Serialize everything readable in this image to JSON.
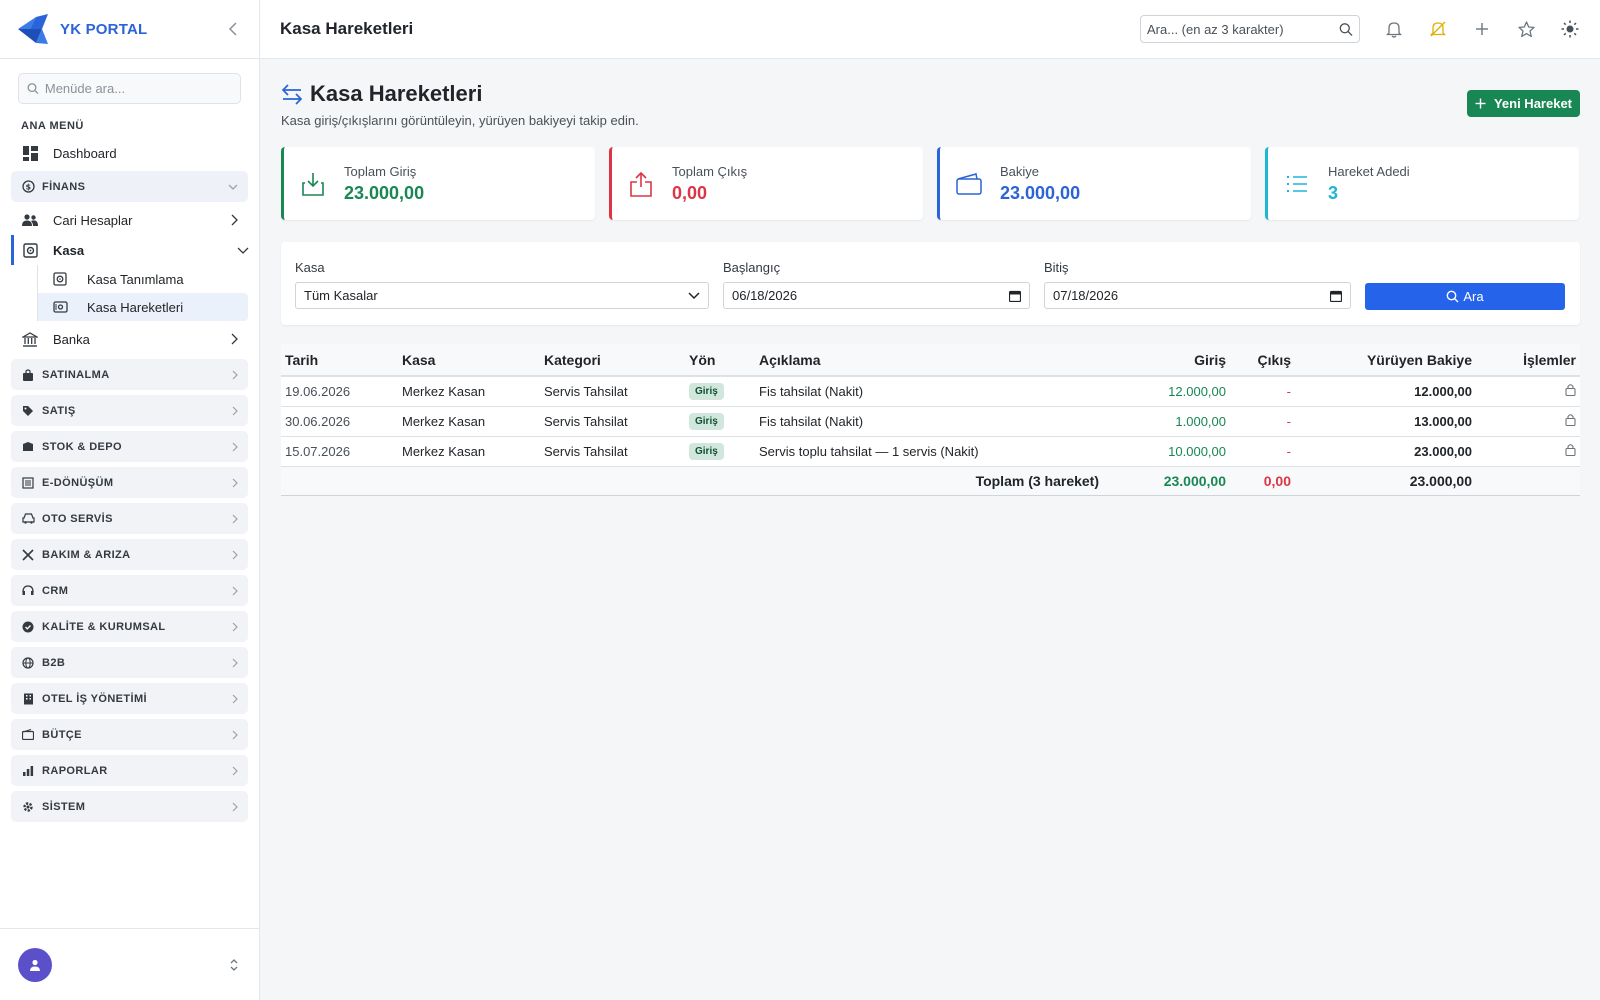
{
  "brand": {
    "name": "YK PORTAL"
  },
  "sidebar": {
    "search_placeholder": "Menüde ara...",
    "section_title": "ANA MENÜ",
    "dashboard": "Dashboard",
    "finans": "FİNANS",
    "cari": "Cari Hesaplar",
    "kasa": "Kasa",
    "kasa_tanimlama": "Kasa Tanımlama",
    "kasa_hareketleri": "Kasa Hareketleri",
    "banka": "Banka",
    "groups": [
      "SATINALMA",
      "SATIŞ",
      "STOK & DEPO",
      "E-DÖNÜŞÜM",
      "OTO SERVİS",
      "BAKIM & ARIZA",
      "CRM",
      "KALİTE & KURUMSAL",
      "B2B",
      "OTEL İŞ YÖNETİMİ",
      "BÜTÇE",
      "RAPORLAR",
      "SİSTEM"
    ]
  },
  "header": {
    "title": "Kasa Hareketleri",
    "search_placeholder": "Ara... (en az 3 karakter)"
  },
  "page": {
    "title": "Kasa Hareketleri",
    "subtitle": "Kasa giriş/çıkışlarını görüntüleyin, yürüyen bakiyeyi takip edin.",
    "new_button": "Yeni Hareket"
  },
  "cards": [
    {
      "label": "Toplam Giriş",
      "value": "23.000,00",
      "color": "#198754"
    },
    {
      "label": "Toplam Çıkış",
      "value": "0,00",
      "color": "#dc3545"
    },
    {
      "label": "Bakiye",
      "value": "23.000,00",
      "color": "#2b63d9"
    },
    {
      "label": "Hareket Adedi",
      "value": "3",
      "color": "#1fb6d4"
    }
  ],
  "filter": {
    "kasa_label": "Kasa",
    "kasa_value": "Tüm Kasalar",
    "start_label": "Başlangıç",
    "start_value": "06/18/2026",
    "end_label": "Bitiş",
    "end_value": "07/18/2026",
    "search_button": "Ara"
  },
  "table": {
    "headers": [
      "Tarih",
      "Kasa",
      "Kategori",
      "Yön",
      "Açıklama",
      "Giriş",
      "Çıkış",
      "Yürüyen Bakiye",
      "İşlemler"
    ],
    "rows": [
      {
        "date": "19.06.2026",
        "kasa": "Merkez Kasan",
        "category": "Servis Tahsilat",
        "direction": "Giriş",
        "desc": "Fis tahsilat (Nakit)",
        "in": "12.000,00",
        "out": "-",
        "balance": "12.000,00"
      },
      {
        "date": "30.06.2026",
        "kasa": "Merkez Kasan",
        "category": "Servis Tahsilat",
        "direction": "Giriş",
        "desc": "Fis tahsilat (Nakit)",
        "in": "1.000,00",
        "out": "-",
        "balance": "13.000,00"
      },
      {
        "date": "15.07.2026",
        "kasa": "Merkez Kasan",
        "category": "Servis Tahsilat",
        "direction": "Giriş",
        "desc": "Servis toplu tahsilat — 1 servis (Nakit)",
        "in": "10.000,00",
        "out": "-",
        "balance": "23.000,00"
      }
    ],
    "footer": {
      "label": "Toplam (3 hareket)",
      "in": "23.000,00",
      "out": "0,00",
      "balance": "23.000,00"
    }
  }
}
